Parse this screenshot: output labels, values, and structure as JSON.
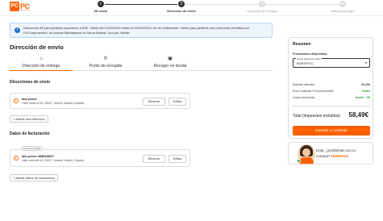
{
  "brand": {
    "logo_box": "PC",
    "logo_text": "PC",
    "logo_sub": "componentes"
  },
  "steps": [
    {
      "label": "Mi cesta",
      "symbol": "✓"
    },
    {
      "label": "Dirección de envío",
      "symbol": "2"
    },
    {
      "label": "Opciones de entrega",
      "symbol": "3"
    },
    {
      "label": "Método de pago",
      "symbol": "4"
    }
  ],
  "banner": {
    "text": "Descuento 5€ para pedidos superiores a 60€. Válido del 01/03/2024 hasta el 31/03/2024 o fin de existencias. Válido para pedidos con productos vendidos por PcComponentes, no incluye Marketplace ni Gama Blanca. Uno por cliente."
  },
  "page_title": "Dirección de envío",
  "tabs": [
    {
      "label": "Dirección de entrega",
      "icon": "home-icon",
      "glyph": "⌂"
    },
    {
      "label": "Punto de recogida",
      "icon": "location-pin-icon",
      "glyph": "⚲"
    },
    {
      "label": "Recoger en tienda",
      "icon": "store-icon",
      "glyph": "▣"
    }
  ],
  "shipping": {
    "title": "Direcciones de envío",
    "address": {
      "name": "lalo perez",
      "line": "Calle coverruf 43, 28007, Madrid, Madrid, España"
    },
    "delete_label": "Eliminar",
    "edit_label": "Editar",
    "add_label": "+ Añadir una dirección"
  },
  "billing": {
    "title": "Datos de facturación",
    "default_badge": "Predeterminada",
    "address": {
      "name": "lalo perez 43881892Y",
      "line": "calle coverufe 43, 28007, Madrid, Madrid, España"
    },
    "delete_label": "Eliminar",
    "edit_label": "Editar",
    "add_label": "+ Añadir datos de facturación"
  },
  "summary": {
    "title": "Resumen",
    "promo_label": "Promociones disponibles",
    "coupon_field_label": "Cupón descuento activo",
    "coupon_value": "BORTIPCC",
    "rows": [
      {
        "label": "Subtotal artículos",
        "value": "63,49€"
      },
      {
        "label": "Envío estándar PcComponentes",
        "value": "Gratis"
      },
      {
        "label": "Cupón descuento",
        "value": "Gratis · -5€"
      }
    ],
    "total_label": "Total (impuestos incluidos)",
    "total_value": "58,49€",
    "save_label": "Guardar y continuar"
  },
  "help": {
    "line1": "Hola, ¿problemas con tu",
    "line2_pre": "compra?",
    "line2_link": "Hablemos"
  },
  "colors": {
    "accent": "#ff6000",
    "info_bg": "#eef4fb",
    "info_border": "#b9d2ef",
    "green": "#2e9e2e"
  }
}
